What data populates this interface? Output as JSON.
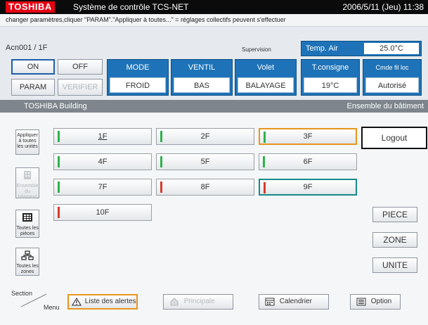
{
  "titlebar": {
    "logo": "TOSHIBA",
    "title": "Système de contrôle TCS-NET",
    "datetime": "2006/5/11 (Jeu) 11:38"
  },
  "instruction": "changer paramètres,cliquer \"PARAM\".\"Appliquer à toutes...\" = réglages collectifs peuvent s'effectuer",
  "panel": {
    "unit_name": "Acn001 / 1F",
    "supervision": "Supervision",
    "temp_air": {
      "label": "Temp. Air",
      "value": "25.0°C"
    },
    "buttons": {
      "on": "ON",
      "off": "OFF",
      "param": "PARAM",
      "verifier": "VERIFIER"
    },
    "mode": {
      "label": "MODE",
      "value": "FROID"
    },
    "ventil": {
      "label": "VENTIL",
      "value": "BAS"
    },
    "volet": {
      "label": "Volet",
      "value": "BALAYAGE"
    },
    "consigne": {
      "label": "T.consigne",
      "value": "19°C"
    },
    "cmde": {
      "label": "Cmde fil loc",
      "value": "Autorisé"
    }
  },
  "building": {
    "name": "TOSHIBA Building",
    "scope": "Ensemble du bâtiment"
  },
  "floors": [
    {
      "label": "1F",
      "status": "green"
    },
    {
      "label": "2F",
      "status": "green"
    },
    {
      "label": "3F",
      "status": "green"
    },
    {
      "label": "4F",
      "status": "green"
    },
    {
      "label": "5F",
      "status": "green"
    },
    {
      "label": "6F",
      "status": "green"
    },
    {
      "label": "7F",
      "status": "green"
    },
    {
      "label": "8F",
      "status": "red"
    },
    {
      "label": "9F",
      "status": "red"
    },
    {
      "label": "10F",
      "status": "red"
    }
  ],
  "colors": {
    "green": "#2db34a",
    "red": "#d83a2a",
    "accent_blue": "#1e73b8",
    "orange": "#e6951e",
    "teal": "#178a8a"
  },
  "side": {
    "apply": "Appliquer à toutes les unités",
    "ensemble": "Ensemble du bâtiment",
    "pieces": "Toutes les pièces",
    "zones": "Toutes les zones"
  },
  "right": {
    "logout": "Logout",
    "piece": "PIECE",
    "zone": "ZONE",
    "unite": "UNITE"
  },
  "footer": {
    "section": "Section",
    "menu": "Menu",
    "alerts": "Liste des alertes",
    "principale": "Principale",
    "calendrier": "Calendrier",
    "option": "Option"
  }
}
